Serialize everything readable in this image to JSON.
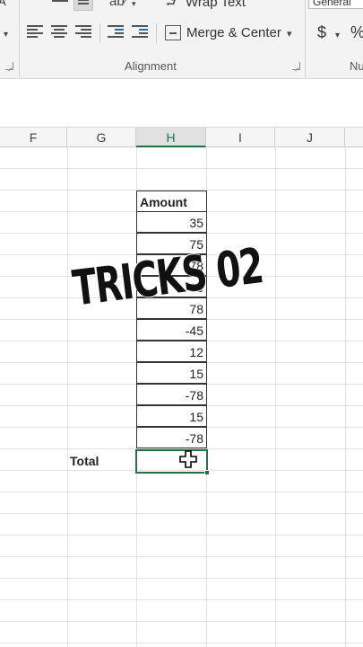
{
  "ribbon": {
    "wrap_text_label": "Wrap Text",
    "merge_center_label": "Merge & Center",
    "merge_dropdown_glyph": "▾",
    "alignment_group_label": "Alignment",
    "number_format_value": "General",
    "number_group_label_partial": "Nu",
    "currency_symbol": "$",
    "percent_symbol": "%",
    "font_group_fragment": "A",
    "icons": [
      "align-left-icon",
      "align-center-icon",
      "align-right-icon",
      "decrease-indent-icon",
      "increase-indent-icon",
      "merge-center-icon",
      "wrap-text-icon",
      "orientation-icon",
      "currency-icon",
      "percent-icon"
    ]
  },
  "columns": [
    "F",
    "G",
    "H",
    "I",
    "J"
  ],
  "active_column": "H",
  "sheet": {
    "header": "Amount",
    "values": [
      "35",
      "75",
      "-78",
      "85",
      "78",
      "-45",
      "12",
      "15",
      "-78",
      "15",
      "-78"
    ],
    "total_label": "Total"
  },
  "overlay": {
    "text": "TRICKS 02"
  },
  "colors": {
    "excel_green": "#217346",
    "ribbon_bg": "#f3f3f3",
    "gridline": "#e2e2e2"
  }
}
